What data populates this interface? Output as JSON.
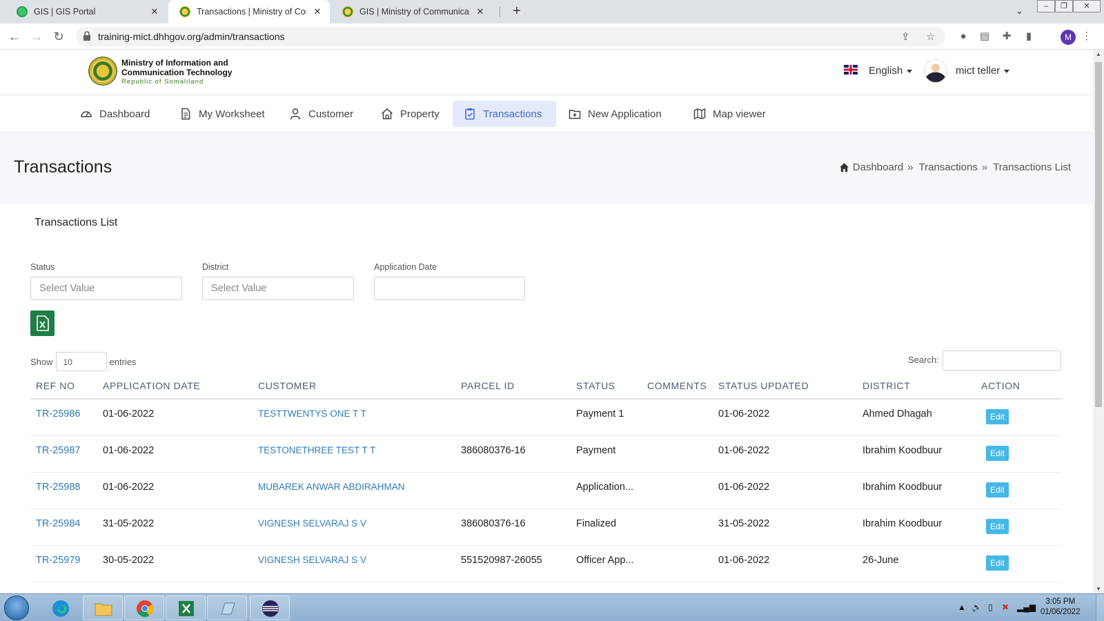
{
  "browser": {
    "tabs": [
      {
        "title": "GIS | GIS Portal"
      },
      {
        "title": "Transactions | Ministry of Communication"
      },
      {
        "title": "GIS | Ministry of Communication"
      }
    ],
    "url": "training-mict.dhhgov.org/admin/transactions",
    "profile_initial": "M"
  },
  "header": {
    "org_line1": "Ministry of Information  and",
    "org_line2": "Communication Technology",
    "org_line3": "Republic of Somaliland",
    "language": "English",
    "user": "mict teller"
  },
  "menu": [
    {
      "label": "Dashboard",
      "icon": "gauge-icon"
    },
    {
      "label": "My Worksheet",
      "icon": "document-icon"
    },
    {
      "label": "Customer",
      "icon": "person-icon"
    },
    {
      "label": "Property",
      "icon": "home-icon"
    },
    {
      "label": "Transactions",
      "icon": "clipboard-check-icon",
      "active": true
    },
    {
      "label": "New Application",
      "icon": "folder-plus-icon"
    },
    {
      "label": "Map viewer",
      "icon": "map-icon"
    }
  ],
  "page": {
    "title": "Transactions",
    "breadcrumb": [
      "Dashboard",
      "Transactions",
      "Transactions List"
    ],
    "breadcrumb_sep": "»"
  },
  "list": {
    "title": "Transactions List",
    "filters": {
      "status_label": "Status",
      "status_placeholder": "Select Value",
      "district_label": "District",
      "district_placeholder": "Select Value",
      "date_label": "Application Date"
    },
    "show_label": "Show",
    "entries_value": "10",
    "entries_label": "entries",
    "search_label": "Search:",
    "columns": [
      "REF NO",
      "APPLICATION DATE",
      "CUSTOMER",
      "PARCEL ID",
      "STATUS",
      "COMMENTS",
      "STATUS UPDATED",
      "DISTRICT",
      "ACTION"
    ],
    "edit_label": "Edit",
    "rows": [
      {
        "ref": "TR-25986",
        "app_date": "01-06-2022",
        "customer": "TESTTWENTYS ONE T T",
        "parcel": "",
        "status": "Payment 1",
        "comments": "",
        "updated": "01-06-2022",
        "district": "Ahmed Dhagah"
      },
      {
        "ref": "TR-25987",
        "app_date": "01-06-2022",
        "customer": "TESTONETHREE TEST T T",
        "parcel": "386080376-16",
        "status": "Payment",
        "comments": "",
        "updated": "01-06-2022",
        "district": "Ibrahim Koodbuur"
      },
      {
        "ref": "TR-25988",
        "app_date": "01-06-2022",
        "customer": "MUBAREK ANWAR ABDIRAHMAN",
        "parcel": "",
        "status": "Application...",
        "comments": "",
        "updated": "01-06-2022",
        "district": "Ibrahim Koodbuur"
      },
      {
        "ref": "TR-25984",
        "app_date": "31-05-2022",
        "customer": "VIGNESH SELVARAJ S V",
        "parcel": "386080376-16",
        "status": "Finalized",
        "comments": "",
        "updated": "31-05-2022",
        "district": "Ibrahim Koodbuur"
      },
      {
        "ref": "TR-25979",
        "app_date": "30-05-2022",
        "customer": "VIGNESH SELVARAJ S V",
        "parcel": "551520987-26055",
        "status": "Officer App...",
        "comments": "",
        "updated": "01-06-2022",
        "district": "26-June"
      }
    ]
  },
  "taskbar": {
    "time": "3:05 PM",
    "date": "01/06/2022"
  }
}
